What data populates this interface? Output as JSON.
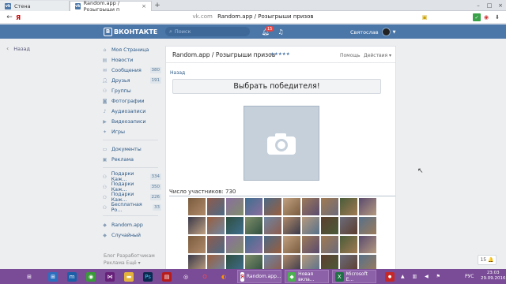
{
  "browser": {
    "tabs": [
      {
        "label": "Стена",
        "active": false
      },
      {
        "label": "Random.app / Розыгрыши п",
        "active": true
      }
    ],
    "url_domain": "vk.com",
    "url_title": "Random.app / Розыгрыши призов",
    "search_letter": "Я"
  },
  "vk": {
    "logo_text": "ВКОНТАКТЕ",
    "logo_letter": "В",
    "search_placeholder": "Поиск",
    "notifications_count": "15",
    "user_name": "Святослав"
  },
  "left_back_label": "Назад",
  "sidebar": {
    "items": [
      {
        "label": "Моя Страница",
        "icon": "home-icon",
        "count": ""
      },
      {
        "label": "Новости",
        "icon": "news-icon",
        "count": ""
      },
      {
        "label": "Сообщения",
        "icon": "message-icon",
        "count": "380"
      },
      {
        "label": "Друзья",
        "icon": "friends-icon",
        "count": "191"
      },
      {
        "label": "Группы",
        "icon": "groups-icon",
        "count": ""
      },
      {
        "label": "Фотографии",
        "icon": "camera-icon",
        "count": ""
      },
      {
        "label": "Аудиозаписи",
        "icon": "audio-icon",
        "count": ""
      },
      {
        "label": "Видеозаписи",
        "icon": "video-icon",
        "count": ""
      },
      {
        "label": "Игры",
        "icon": "games-icon",
        "count": ""
      },
      {
        "label": "Документы",
        "icon": "document-icon",
        "count": ""
      },
      {
        "label": "Реклама",
        "icon": "ads-icon",
        "count": ""
      },
      {
        "label": "Подарки Каж...",
        "icon": "group-icon",
        "count": "334"
      },
      {
        "label": "Подарки Каж...",
        "icon": "group-icon",
        "count": "350"
      },
      {
        "label": "Подарки Каж...",
        "icon": "group-icon",
        "count": "226"
      },
      {
        "label": "Бесплатная Ро...",
        "icon": "group-icon",
        "count": "33"
      },
      {
        "label": "Random.app",
        "icon": "app-icon",
        "count": ""
      },
      {
        "label": "Случайный",
        "icon": "app-icon",
        "count": ""
      }
    ],
    "footer_line1": "Блог  Разработчикам",
    "footer_line2": "Реклама  Ещё ▾"
  },
  "main": {
    "title": "Random.app / Розыгрыши призов",
    "stars": "★★★★★",
    "help_label": "Помощь",
    "actions_label": "Действия ▾",
    "back_label": "Назад",
    "winner_button": "Выбрать победителя!",
    "participants_label": "Число участников: 730"
  },
  "right_button_label": "15 🔔",
  "taskbar": {
    "apps": [
      {
        "label": "Random.app..."
      },
      {
        "label": "Новая вкла..."
      },
      {
        "label": "Microsoft E..."
      }
    ],
    "language": "РУС",
    "time": "23:03",
    "date": "29.09.2016"
  },
  "colors": {
    "vk_blue": "#4a76a8",
    "taskbar": "#7a4b97",
    "page_bg": "#edeef0"
  }
}
